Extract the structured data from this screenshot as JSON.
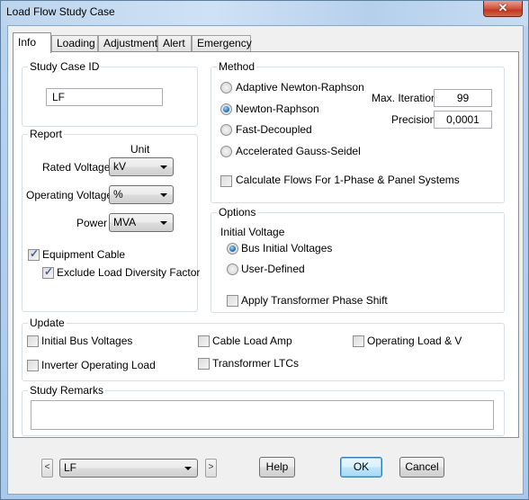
{
  "window": {
    "title": "Load Flow Study Case",
    "close_glyph": "✕"
  },
  "tabs": [
    {
      "label": "Info",
      "active": true
    },
    {
      "label": "Loading",
      "active": false
    },
    {
      "label": "Adjustment",
      "active": false
    },
    {
      "label": "Alert",
      "active": false
    },
    {
      "label": "Emergency",
      "active": false
    }
  ],
  "study_case_id": {
    "group_label": "Study Case ID",
    "value": "LF"
  },
  "report": {
    "group_label": "Report",
    "unit_header": "Unit",
    "rated_voltage": {
      "label": "Rated Voltage",
      "value": "kV"
    },
    "operating_voltage": {
      "label": "Operating Voltage",
      "value": "%"
    },
    "power": {
      "label": "Power",
      "value": "MVA"
    },
    "equipment_cable": {
      "label": "Equipment Cable",
      "checked": true
    },
    "exclude_load_diversity": {
      "label": "Exclude Load Diversity Factor",
      "checked": true
    }
  },
  "method": {
    "group_label": "Method",
    "options": [
      {
        "label": "Adaptive Newton-Raphson",
        "selected": false
      },
      {
        "label": "Newton-Raphson",
        "selected": true
      },
      {
        "label": "Fast-Decoupled",
        "selected": false
      },
      {
        "label": "Accelerated Gauss-Seidel",
        "selected": false
      }
    ],
    "max_iteration": {
      "label": "Max. Iteration",
      "value": "99"
    },
    "precision": {
      "label": "Precision",
      "value": "0,0001"
    },
    "calc_flows": {
      "label": "Calculate Flows For 1-Phase & Panel Systems",
      "checked": false
    }
  },
  "options": {
    "group_label": "Options",
    "initial_voltage_label": "Initial Voltage",
    "initial_voltage_options": [
      {
        "label": "Bus Initial Voltages",
        "selected": true
      },
      {
        "label": "User-Defined",
        "selected": false
      }
    ],
    "apply_phase_shift": {
      "label": "Apply Transformer Phase Shift",
      "checked": false
    }
  },
  "update": {
    "group_label": "Update",
    "items": [
      {
        "label": "Initial Bus Voltages",
        "checked": false
      },
      {
        "label": "Cable Load Amp",
        "checked": false
      },
      {
        "label": "Operating Load & V",
        "checked": false
      },
      {
        "label": "Inverter Operating Load",
        "checked": false
      },
      {
        "label": "Transformer LTCs",
        "checked": false
      }
    ]
  },
  "remarks": {
    "group_label": "Study Remarks",
    "value": ""
  },
  "footer": {
    "prev_glyph": "<",
    "next_glyph": ">",
    "case_select_value": "LF",
    "help_label": "Help",
    "ok_label": "OK",
    "cancel_label": "Cancel"
  }
}
